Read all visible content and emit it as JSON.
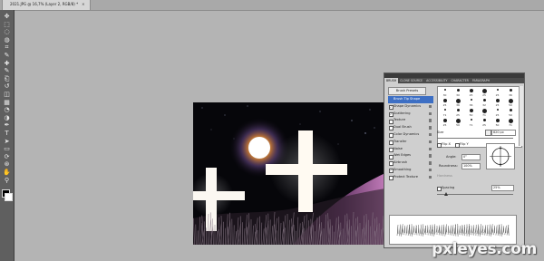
{
  "document_tab": {
    "title": "2021.JPG @ 16,7% (Layer 2, RGB/8) *",
    "close_glyph": "✕"
  },
  "toolbar": {
    "tools": [
      "move-tool-icon",
      "marquee-tool-icon",
      "lasso-tool-icon",
      "quick-select-tool-icon",
      "crop-tool-icon",
      "eyedropper-tool-icon",
      "healing-brush-tool-icon",
      "brush-tool-icon",
      "clone-stamp-tool-icon",
      "history-brush-tool-icon",
      "eraser-tool-icon",
      "gradient-tool-icon",
      "blur-tool-icon",
      "dodge-tool-icon",
      "pen-tool-icon",
      "type-tool-icon",
      "path-select-tool-icon",
      "shape-tool-icon",
      "3d-rotate-tool-icon",
      "3d-orbit-tool-icon",
      "hand-tool-icon",
      "zoom-tool-icon"
    ],
    "glyphs": [
      "✥",
      "⬚",
      "◌",
      "◍",
      "⌗",
      "✎",
      "✚",
      "✎",
      "⎗",
      "↺",
      "◫",
      "▦",
      "◔",
      "◑",
      "✒",
      "T",
      "➤",
      "▭",
      "⟳",
      "⊛",
      "✋",
      "⚲"
    ],
    "foreground_color": "#000000",
    "background_color": "#ffffff"
  },
  "brush_panel": {
    "tabs": [
      "Brush",
      "Clone Source",
      "Accessibility",
      "Character",
      "Paragraph"
    ],
    "presets_button": "Brush Presets",
    "options": [
      {
        "label": "Brush Tip Shape",
        "checked": false,
        "selected": true
      },
      {
        "label": "Shape Dynamics",
        "checked": true,
        "selected": false
      },
      {
        "label": "Scattering",
        "checked": true,
        "selected": false
      },
      {
        "label": "Texture",
        "checked": false,
        "selected": false
      },
      {
        "label": "Dual Brush",
        "checked": false,
        "selected": false
      },
      {
        "label": "Color Dynamics",
        "checked": false,
        "selected": false
      },
      {
        "label": "Transfer",
        "checked": false,
        "selected": false
      },
      {
        "label": "Noise",
        "checked": false,
        "selected": false
      },
      {
        "label": "Wet Edges",
        "checked": false,
        "selected": false
      },
      {
        "label": "Airbrush",
        "checked": false,
        "selected": false
      },
      {
        "label": "Smoothing",
        "checked": true,
        "selected": false
      },
      {
        "label": "Protect Texture",
        "checked": false,
        "selected": false
      }
    ],
    "brush_tips": [
      "30",
      "30",
      "25",
      "25",
      "25",
      "36",
      "25",
      "36",
      "36",
      "32",
      "25",
      "50",
      "71",
      "25",
      "50",
      "71",
      "25",
      "50",
      "25",
      "50",
      "71",
      "25",
      "50",
      "71"
    ],
    "size_label": "Size",
    "size_value": "820 px",
    "flip_x": "Flip X",
    "flip_y": "Flip Y",
    "angle_label": "Angle:",
    "angle_value": "0°",
    "roundness_label": "Roundness:",
    "roundness_value": "100%",
    "hardness_label": "Hardness",
    "spacing_label": "Spacing",
    "spacing_value": "25%"
  },
  "watermark": "pxleyes.com"
}
